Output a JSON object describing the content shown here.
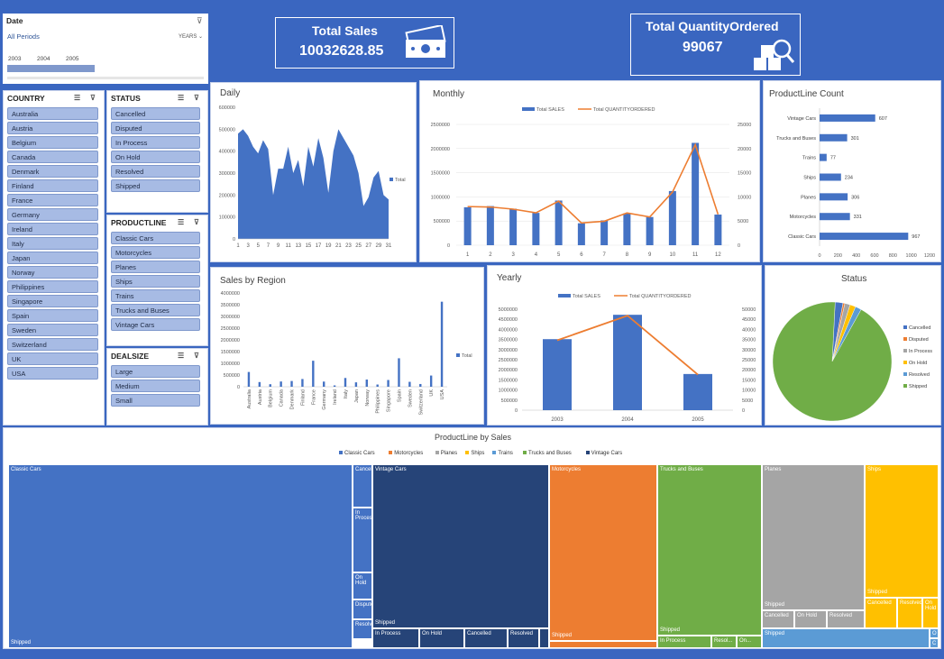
{
  "date_slicer": {
    "title": "Date",
    "period": "All Periods",
    "mode": "YEARS",
    "years": [
      "2003",
      "2004",
      "2005"
    ]
  },
  "country_slicer": {
    "title": "COUNTRY",
    "items": [
      "Australia",
      "Austria",
      "Belgium",
      "Canada",
      "Denmark",
      "Finland",
      "France",
      "Germany",
      "Ireland",
      "Italy",
      "Japan",
      "Norway",
      "Philippines",
      "Singapore",
      "Spain",
      "Sweden",
      "Switzerland",
      "UK",
      "USA"
    ]
  },
  "status_slicer": {
    "title": "STATUS",
    "items": [
      "Cancelled",
      "Disputed",
      "In Process",
      "On Hold",
      "Resolved",
      "Shipped"
    ]
  },
  "productline_slicer": {
    "title": "PRODUCTLINE",
    "items": [
      "Classic Cars",
      "Motorcycles",
      "Planes",
      "Ships",
      "Trains",
      "Trucks and Buses",
      "Vintage Cars"
    ]
  },
  "dealsize_slicer": {
    "title": "DEALSIZE",
    "items": [
      "Large",
      "Medium",
      "Small"
    ]
  },
  "kpi": {
    "sales_title": "Total Sales",
    "sales_value": "10032628.85",
    "qty_title": "Total QuantityOrdered",
    "qty_value": "99067"
  },
  "titles": {
    "daily": "Daily",
    "monthly": "Monthly",
    "productline_count": "ProductLine Count",
    "region": "Sales by Region",
    "yearly": "Yearly",
    "status": "Status",
    "treemap": "ProductLine by Sales"
  },
  "colors": {
    "blue": "#4472c4",
    "orange": "#ed7d31",
    "gray": "#a5a5a5",
    "yellow": "#ffc000",
    "lightblue": "#5b9bd5",
    "green": "#70ad47",
    "navy": "#264478"
  },
  "chart_data": [
    {
      "type": "area",
      "id": "daily",
      "x": [
        1,
        2,
        3,
        4,
        5,
        6,
        7,
        8,
        9,
        10,
        11,
        12,
        13,
        14,
        15,
        16,
        17,
        18,
        19,
        20,
        21,
        22,
        23,
        24,
        25,
        26,
        27,
        28,
        29,
        30,
        31
      ],
      "x_tick_labels": [
        "1",
        "3",
        "5",
        "7",
        "9",
        "11",
        "13",
        "15",
        "17",
        "19",
        "21",
        "23",
        "25",
        "27",
        "29",
        "31"
      ],
      "series": [
        {
          "name": "Total",
          "values": [
            480000,
            500000,
            470000,
            420000,
            390000,
            450000,
            410000,
            200000,
            320000,
            320000,
            420000,
            300000,
            360000,
            240000,
            420000,
            330000,
            460000,
            370000,
            210000,
            400000,
            500000,
            460000,
            420000,
            380000,
            300000,
            150000,
            190000,
            280000,
            310000,
            200000,
            180000
          ]
        }
      ],
      "ylim": [
        0,
        600000
      ],
      "y_ticks": [
        "0",
        "100000",
        "200000",
        "300000",
        "400000",
        "500000",
        "600000"
      ]
    },
    {
      "type": "bar",
      "id": "monthly",
      "categories": [
        "1",
        "2",
        "3",
        "4",
        "5",
        "6",
        "7",
        "8",
        "9",
        "10",
        "11",
        "12"
      ],
      "series": [
        {
          "name": "Total SALES",
          "values": [
            785000,
            810000,
            755000,
            669000,
            924000,
            454000,
            514000,
            659000,
            584000,
            1121000,
            2118000,
            634000
          ]
        },
        {
          "name": "Total QUANTITYORDERED",
          "values": [
            7997,
            7903,
            7462,
            6704,
            9115,
            4597,
            4962,
            6669,
            5844,
            11000,
            20800,
            6400
          ]
        }
      ],
      "ylim": [
        0,
        2500000
      ],
      "y2lim": [
        0,
        25000
      ],
      "y_ticks": [
        "0",
        "500000",
        "1000000",
        "1500000",
        "2000000",
        "2500000"
      ],
      "y2_ticks": [
        "0",
        "5000",
        "10000",
        "15000",
        "20000",
        "25000"
      ]
    },
    {
      "type": "bar",
      "id": "productline_count",
      "orientation": "horizontal",
      "categories": [
        "Vintage Cars",
        "Trucks and Buses",
        "Trains",
        "Ships",
        "Planes",
        "Motorcycles",
        "Classic Cars"
      ],
      "values": [
        607,
        301,
        77,
        234,
        306,
        331,
        967
      ],
      "xlim": [
        0,
        1200
      ],
      "x_ticks": [
        "0",
        "200",
        "400",
        "600",
        "800",
        "1000",
        "1200"
      ]
    },
    {
      "type": "bar",
      "id": "region",
      "categories": [
        "Australia",
        "Austria",
        "Belgium",
        "Canada",
        "Denmark",
        "Finland",
        "France",
        "Germany",
        "Ireland",
        "Italy",
        "Japan",
        "Norway",
        "Philippines",
        "Singapore",
        "Spain",
        "Sweden",
        "Switzerland",
        "UK",
        "USA"
      ],
      "series": [
        {
          "name": "Total",
          "values": [
            630000,
            200000,
            108000,
            224000,
            245000,
            330000,
            1110000,
            220000,
            57000,
            374000,
            188000,
            307000,
            95000,
            288000,
            1215000,
            210000,
            117000,
            478000,
            3628000
          ]
        }
      ],
      "ylim": [
        0,
        4000000
      ],
      "y_ticks": [
        "0",
        "500000",
        "1000000",
        "1500000",
        "2000000",
        "2500000",
        "3000000",
        "3500000",
        "4000000"
      ]
    },
    {
      "type": "bar",
      "id": "yearly",
      "categories": [
        "2003",
        "2004",
        "2005"
      ],
      "series": [
        {
          "name": "Total SALES",
          "values": [
            3516980,
            4724163,
            1791487
          ]
        },
        {
          "name": "Total QUANTITYORDERED",
          "values": [
            34612,
            46824,
            17631
          ]
        }
      ],
      "ylim": [
        0,
        5000000
      ],
      "y2lim": [
        0,
        50000
      ],
      "y_ticks": [
        "0",
        "500000",
        "1000000",
        "1500000",
        "2000000",
        "2500000",
        "3000000",
        "3500000",
        "4000000",
        "4500000",
        "5000000"
      ],
      "y2_ticks": [
        "0",
        "5000",
        "10000",
        "15000",
        "20000",
        "25000",
        "30000",
        "35000",
        "40000",
        "45000",
        "50000"
      ]
    },
    {
      "type": "pie",
      "id": "status",
      "categories": [
        "Cancelled",
        "Disputed",
        "In Process",
        "On Hold",
        "Resolved",
        "Shipped"
      ],
      "values": [
        60,
        14,
        41,
        44,
        47,
        2617
      ]
    },
    {
      "type": "heatmap",
      "id": "treemap",
      "subtype": "treemap",
      "legend": [
        "Classic Cars",
        "Motorcycles",
        "Planes",
        "Ships",
        "Trains",
        "Trucks and Buses",
        "Vintage Cars"
      ],
      "children": [
        {
          "name": "Classic Cars",
          "sub": [
            "Shipped",
            "Cancelled",
            "In Process",
            "On Hold",
            "Disputed",
            "Resolved"
          ]
        },
        {
          "name": "Vintage Cars",
          "sub": [
            "Shipped",
            "In Process",
            "On Hold",
            "Cancelled",
            "Resolved"
          ]
        },
        {
          "name": "Motorcycles",
          "sub": [
            "Shipped"
          ]
        },
        {
          "name": "Trucks and Buses",
          "sub": [
            "Shipped",
            "In Process",
            "Resol...",
            "On..."
          ]
        },
        {
          "name": "Planes",
          "sub": [
            "Shipped",
            "Cancelled",
            "On Hold",
            "Resolved"
          ]
        },
        {
          "name": "Ships",
          "sub": [
            "Shipped",
            "Cancelled",
            "Resolved",
            "On Hold"
          ]
        }
      ],
      "small_labels": [
        "Cancelled",
        "In Process",
        "On Hold",
        "Disputed",
        "Resolved",
        "O",
        "C"
      ]
    }
  ]
}
